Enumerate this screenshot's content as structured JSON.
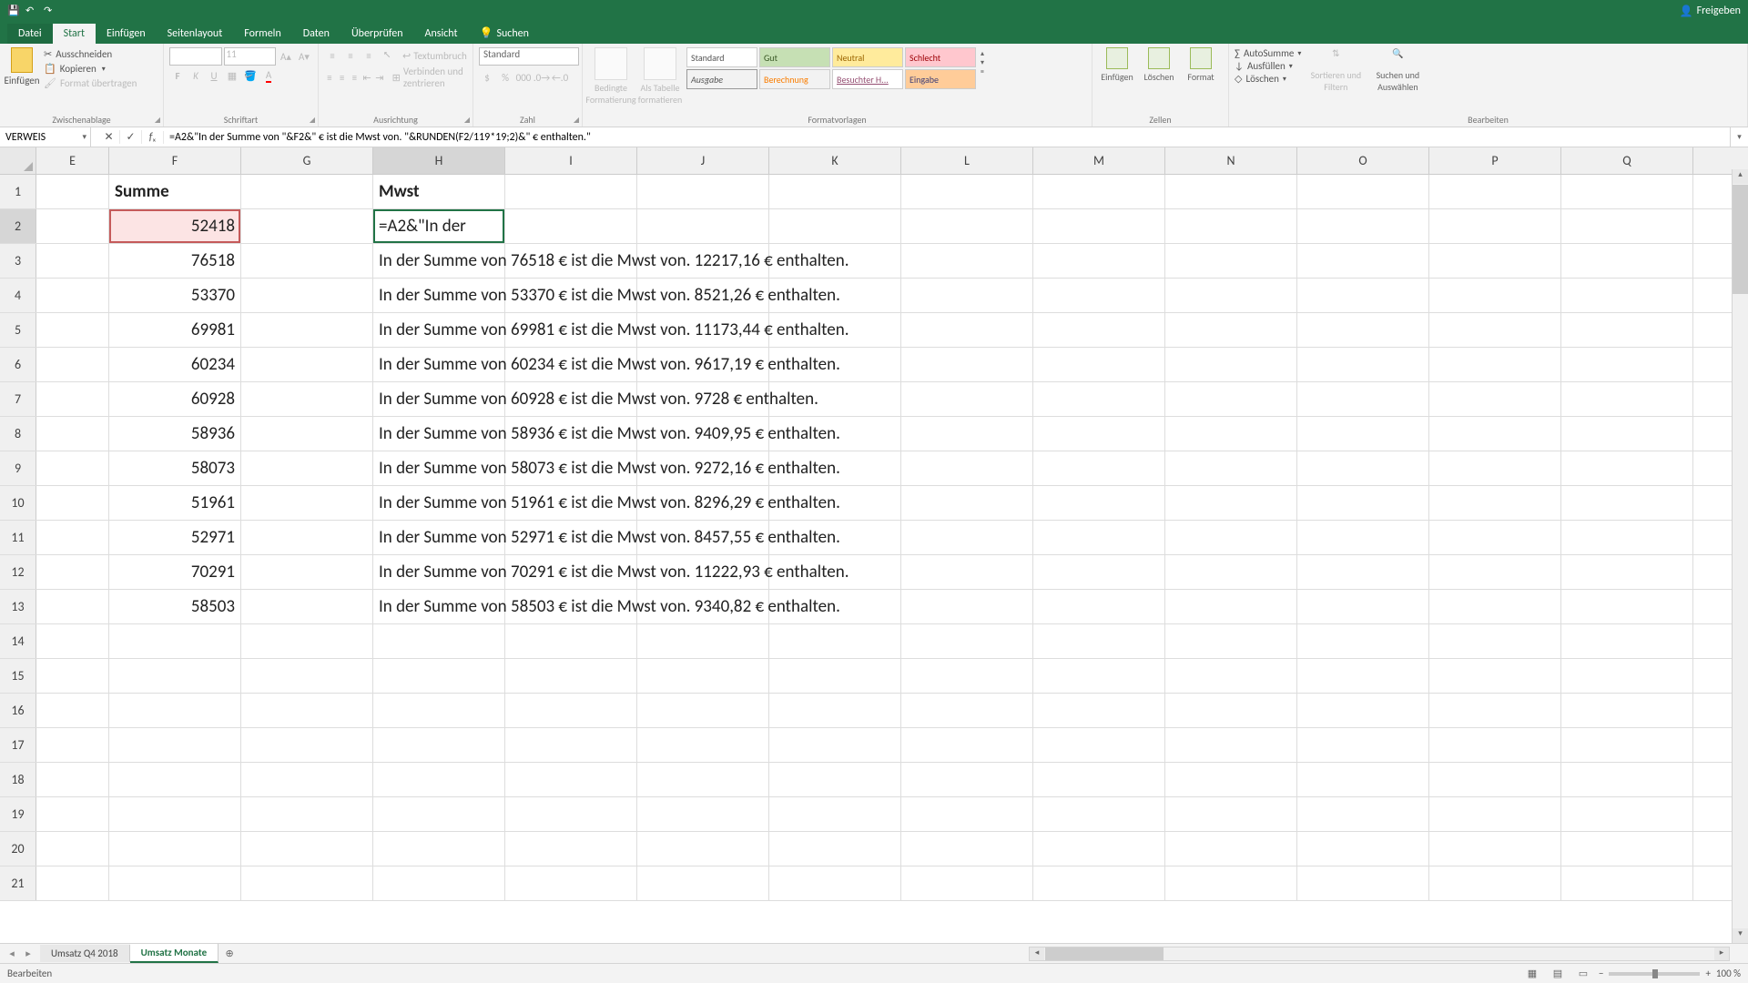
{
  "titlebar": {
    "share": "Freigeben"
  },
  "tabs": {
    "file": "Datei",
    "start": "Start",
    "einfugen": "Einfügen",
    "seitenlayout": "Seitenlayout",
    "formeln": "Formeln",
    "daten": "Daten",
    "uberprufen": "Überprüfen",
    "ansicht": "Ansicht",
    "suchen": "Suchen"
  },
  "ribbon": {
    "clipboard": {
      "label": "Zwischenablage",
      "paste": "Einfügen",
      "cut": "Ausschneiden",
      "copy": "Kopieren",
      "format_painter": "Format übertragen"
    },
    "font": {
      "label": "Schriftart",
      "font_name": "",
      "font_size": "11"
    },
    "alignment": {
      "label": "Ausrichtung",
      "wrap": "Textumbruch",
      "merge": "Verbinden und zentrieren"
    },
    "number": {
      "label": "Zahl",
      "format": "Standard"
    },
    "styles": {
      "label": "Formatvorlagen",
      "conditional": "Bedingte Formatierung",
      "as_table": "Als Tabelle formatieren",
      "standard": "Standard",
      "gut": "Gut",
      "neutral": "Neutral",
      "schlecht": "Schlecht",
      "ausgabe": "Ausgabe",
      "berechnung": "Berechnung",
      "besuchter": "Besuchter H...",
      "eingabe": "Eingabe"
    },
    "cells": {
      "label": "Zellen",
      "insert": "Einfügen",
      "delete": "Löschen",
      "format": "Format"
    },
    "editing": {
      "label": "Bearbeiten",
      "autosum": "AutoSumme",
      "fill": "Ausfüllen",
      "clear": "Löschen",
      "sort": "Sortieren und Filtern",
      "find": "Suchen und Auswählen"
    }
  },
  "namebox": "VERWEIS",
  "formula": "=A2&\"In der Summe von \"&F2&\" € ist die Mwst von. \"&RUNDEN(F2/119*19;2)&\" € enthalten.\"",
  "columns": [
    "E",
    "F",
    "G",
    "H",
    "I",
    "J",
    "K",
    "L",
    "M",
    "N",
    "O",
    "P",
    "Q"
  ],
  "rows_count": 21,
  "active_col": "H",
  "active_row": 2,
  "headers": {
    "F1": "Summe",
    "H1": "Mwst"
  },
  "h2_display": "=A2&\"In der",
  "chart_data": {
    "type": "table",
    "columns": [
      "row",
      "Summe",
      "Mwst_text"
    ],
    "rows": [
      {
        "row": 2,
        "Summe": 52418,
        "Mwst_text": "=A2&\"In der"
      },
      {
        "row": 3,
        "Summe": 76518,
        "Mwst_text": "In der Summe von 76518 € ist die Mwst von. 12217,16 € enthalten."
      },
      {
        "row": 4,
        "Summe": 53370,
        "Mwst_text": "In der Summe von 53370 € ist die Mwst von. 8521,26 € enthalten."
      },
      {
        "row": 5,
        "Summe": 69981,
        "Mwst_text": "In der Summe von 69981 € ist die Mwst von. 11173,44 € enthalten."
      },
      {
        "row": 6,
        "Summe": 60234,
        "Mwst_text": "In der Summe von 60234 € ist die Mwst von. 9617,19 € enthalten."
      },
      {
        "row": 7,
        "Summe": 60928,
        "Mwst_text": "In der Summe von 60928 € ist die Mwst von. 9728 € enthalten."
      },
      {
        "row": 8,
        "Summe": 58936,
        "Mwst_text": "In der Summe von 58936 € ist die Mwst von. 9409,95 € enthalten."
      },
      {
        "row": 9,
        "Summe": 58073,
        "Mwst_text": "In der Summe von 58073 € ist die Mwst von. 9272,16 € enthalten."
      },
      {
        "row": 10,
        "Summe": 51961,
        "Mwst_text": "In der Summe von 51961 € ist die Mwst von. 8296,29 € enthalten."
      },
      {
        "row": 11,
        "Summe": 52971,
        "Mwst_text": "In der Summe von 52971 € ist die Mwst von. 8457,55 € enthalten."
      },
      {
        "row": 12,
        "Summe": 70291,
        "Mwst_text": "In der Summe von 70291 € ist die Mwst von. 11222,93 € enthalten."
      },
      {
        "row": 13,
        "Summe": 58503,
        "Mwst_text": "In der Summe von 58503 € ist die Mwst von. 9340,82 € enthalten."
      }
    ]
  },
  "sheets": {
    "tab1": "Umsatz Q4 2018",
    "tab2": "Umsatz Monate"
  },
  "status": {
    "mode": "Bearbeiten",
    "zoom": "100 %"
  }
}
